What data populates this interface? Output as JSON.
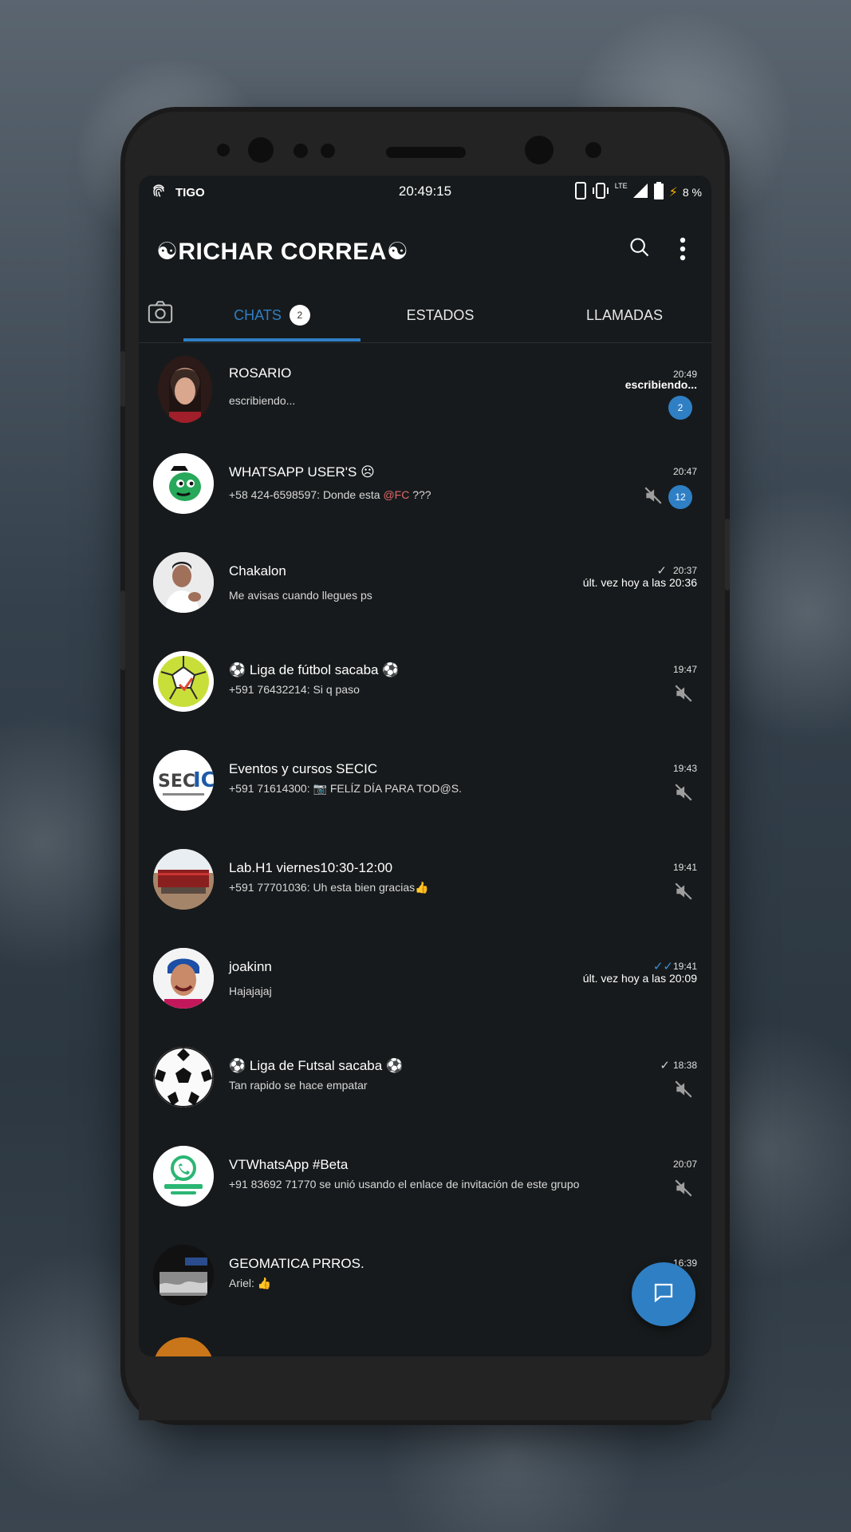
{
  "status_bar": {
    "carrier": "TIGO",
    "time": "20:49:15",
    "network": "LTE",
    "battery": "8 %"
  },
  "app": {
    "title": "☯RICHAR CORREA☯"
  },
  "tabs": [
    {
      "label": "CHATS",
      "badge": "2",
      "active": true
    },
    {
      "label": "ESTADOS",
      "active": false
    },
    {
      "label": "LLAMADAS",
      "active": false
    }
  ],
  "chats": [
    {
      "name": "ROSARIO",
      "message": "escribiendo...",
      "time": "20:49",
      "sub": "escribiendo...",
      "unread": "2",
      "muted": false,
      "tick": ""
    },
    {
      "name": "WHATSAPP USER'S ☹",
      "message_prefix": "+58 424-6598597: Donde esta ",
      "message_highlight": "@FC",
      "message_suffix": " ???",
      "time": "20:47",
      "unread": "12",
      "muted": true,
      "tick": ""
    },
    {
      "name": "Chakalon",
      "message": "Me avisas cuando llegues ps",
      "time": "20:37",
      "sub": "últ. vez hoy a las 20:36",
      "muted": false,
      "tick": "✓"
    },
    {
      "name": "⚽ Liga de fútbol sacaba ⚽",
      "message": "+591 76432214: Si q paso",
      "time": "19:47",
      "muted": true,
      "tick": ""
    },
    {
      "name": "Eventos y cursos SECIC",
      "message": "+591 71614300: 📷 FELÍZ DÍA PARA TOD@S.",
      "time": "19:43",
      "muted": true,
      "tick": ""
    },
    {
      "name": "Lab.H1 viernes10:30-12:00",
      "message": "+591 77701036: Uh esta bien gracias👍",
      "time": "19:41",
      "muted": true,
      "tick": ""
    },
    {
      "name": "joakinn",
      "message": "Hajajajaj",
      "time": "19:41",
      "sub": "últ. vez hoy a las 20:09",
      "muted": false,
      "tick": "✓✓"
    },
    {
      "name": "⚽ Liga de Futsal sacaba ⚽",
      "message": "Tan rapido se hace empatar",
      "time": "18:38",
      "muted": true,
      "tick": "✓"
    },
    {
      "name": "VTWhatsApp #Beta",
      "message": "+91 83692 71770 se unió usando el enlace de invitación de este grupo",
      "time": "20:07",
      "muted": true,
      "tick": ""
    },
    {
      "name": "GEOMATICA PRROS.",
      "message": "Ariel: 👍",
      "time": "16:39",
      "muted": false,
      "tick": ""
    }
  ],
  "icons": {
    "fingerprint": "fingerprint-icon",
    "search": "search-icon",
    "menu": "more-vert-icon",
    "camera": "camera-icon",
    "mute": "mute-icon",
    "new_chat": "new-chat-icon"
  },
  "colors": {
    "accent": "#2f7fc4",
    "background": "#171a1c",
    "highlight": "#e06a6a"
  }
}
